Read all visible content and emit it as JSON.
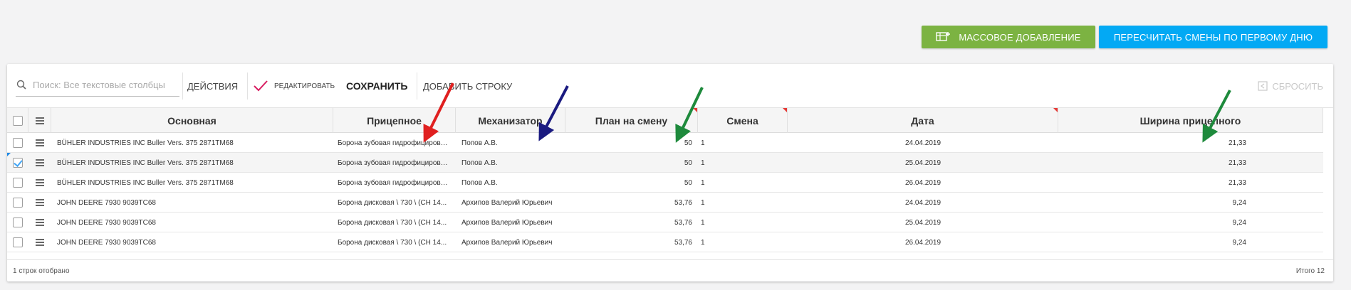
{
  "buttons": {
    "mass_add": "МАССОВОЕ ДОБАВЛЕНИЕ",
    "recalc": "ПЕРЕСЧИТАТЬ СМЕНЫ ПО ПЕРВОМУ ДНЮ"
  },
  "toolbar": {
    "search_placeholder": "Поиск: Все текстовые столбцы",
    "actions": "ДЕЙСТВИЯ",
    "edit": "РЕДАКТИРОВАТЬ",
    "save": "СОХРАНИТЬ",
    "add_row": "ДОБАВИТЬ СТРОКУ",
    "reset": "СБРОСИТЬ"
  },
  "columns": [
    "Основная",
    "Прицепное",
    "Механизатор",
    "План на смену",
    "Смена",
    "Дата",
    "Ширина прицепного"
  ],
  "rows": [
    {
      "main": "BÜHLER INDUSTRIES INC Buller Vers. 375 2871ТМ68",
      "trailer": "Борона зубовая гидрофицированная",
      "operator": "Попов А.В.",
      "plan": "50",
      "shift": "1",
      "date": "24.04.2019",
      "width": "21,33",
      "checked": false
    },
    {
      "main": "BÜHLER INDUSTRIES INC Buller Vers. 375 2871ТМ68",
      "trailer": "Борона зубовая гидрофицированная",
      "operator": "Попов А.В.",
      "plan": "50",
      "shift": "1",
      "date": "25.04.2019",
      "width": "21,33",
      "checked": true
    },
    {
      "main": "BÜHLER INDUSTRIES INC Buller Vers. 375 2871ТМ68",
      "trailer": "Борона зубовая гидрофицированная",
      "operator": "Попов А.В.",
      "plan": "50",
      "shift": "1",
      "date": "26.04.2019",
      "width": "21,33",
      "checked": false
    },
    {
      "main": "JOHN DEERE 7930 9039ТС68",
      "trailer": "Борона дисковая \\ 730 \\ (СН 14...",
      "operator": "Архипов Валерий Юрьевич",
      "plan": "53,76",
      "shift": "1",
      "date": "24.04.2019",
      "width": "9,24",
      "checked": false
    },
    {
      "main": "JOHN DEERE 7930 9039ТС68",
      "trailer": "Борона дисковая \\ 730 \\ (СН 14...",
      "operator": "Архипов Валерий Юрьевич",
      "plan": "53,76",
      "shift": "1",
      "date": "25.04.2019",
      "width": "9,24",
      "checked": false
    },
    {
      "main": "JOHN DEERE 7930 9039ТС68",
      "trailer": "Борона дисковая \\ 730 \\ (СН 14...",
      "operator": "Архипов Валерий Юрьевич",
      "plan": "53,76",
      "shift": "1",
      "date": "26.04.2019",
      "width": "9,24",
      "checked": false
    }
  ],
  "footer": {
    "selected": "1 строк отобрано",
    "total": "Итого 12"
  },
  "colors": {
    "mass_add_bg": "#7cb342",
    "recalc_bg": "#03a9f4",
    "edit_check": "#d81b60",
    "arrow_red": "#e02020",
    "arrow_navy": "#1a1a80",
    "arrow_green": "#1e8a3c"
  },
  "icons": [
    "table-add-icon",
    "search-icon",
    "check-icon",
    "reset-icon",
    "menu-icon"
  ]
}
